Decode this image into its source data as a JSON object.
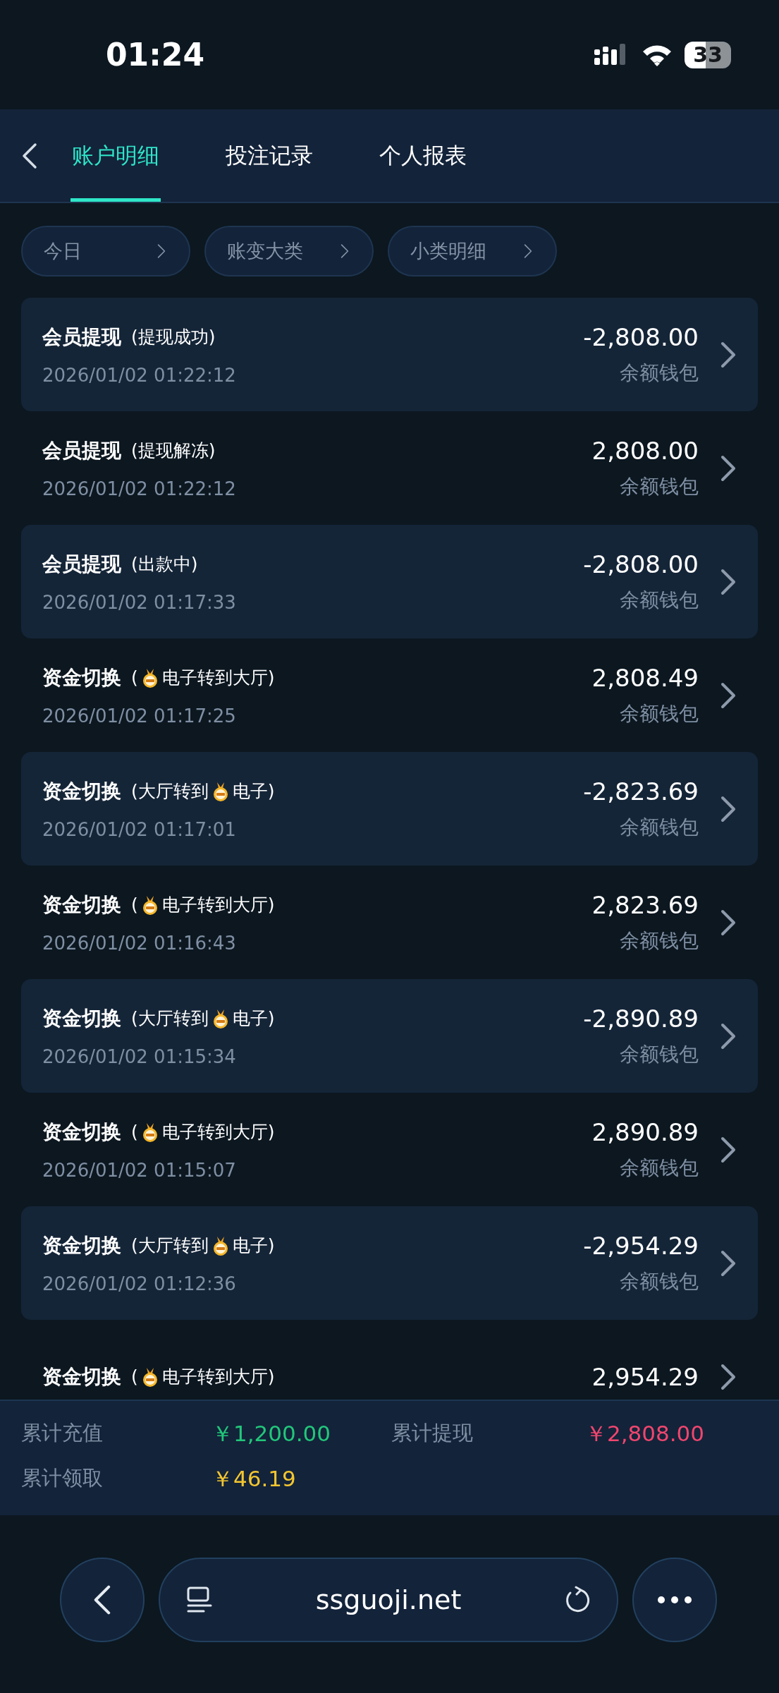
{
  "status_bar": {
    "time": "01:24",
    "battery": "33"
  },
  "tabs": [
    {
      "label": "账户明细",
      "selected": true
    },
    {
      "label": "投注记录",
      "selected": false
    },
    {
      "label": "个人报表",
      "selected": false
    }
  ],
  "filters": [
    {
      "label": "今日"
    },
    {
      "label": "账变大类"
    },
    {
      "label": "小类明细"
    }
  ],
  "records": [
    {
      "title": "会员提现",
      "detail": [
        {
          "kind": "text",
          "text": "(提现成功)"
        }
      ],
      "date": "2026/01/02 01:22:12",
      "amount": "-2,808.00",
      "wallet": "余额钱包"
    },
    {
      "title": "会员提现",
      "detail": [
        {
          "kind": "text",
          "text": "(提现解冻)"
        }
      ],
      "date": "2026/01/02 01:22:12",
      "amount": "2,808.00",
      "wallet": "余额钱包"
    },
    {
      "title": "会员提现",
      "detail": [
        {
          "kind": "text",
          "text": "(出款中)"
        }
      ],
      "date": "2026/01/02 01:17:33",
      "amount": "-2,808.00",
      "wallet": "余额钱包"
    },
    {
      "title": "资金切换",
      "detail": [
        {
          "kind": "text",
          "text": "("
        },
        {
          "kind": "coin"
        },
        {
          "kind": "text",
          "text": "电子转到大厅)"
        }
      ],
      "date": "2026/01/02 01:17:25",
      "amount": "2,808.49",
      "wallet": "余额钱包"
    },
    {
      "title": "资金切换",
      "detail": [
        {
          "kind": "text",
          "text": "(大厅转到"
        },
        {
          "kind": "coin"
        },
        {
          "kind": "text",
          "text": "电子)"
        }
      ],
      "date": "2026/01/02 01:17:01",
      "amount": "-2,823.69",
      "wallet": "余额钱包"
    },
    {
      "title": "资金切换",
      "detail": [
        {
          "kind": "text",
          "text": "("
        },
        {
          "kind": "coin"
        },
        {
          "kind": "text",
          "text": "电子转到大厅)"
        }
      ],
      "date": "2026/01/02 01:16:43",
      "amount": "2,823.69",
      "wallet": "余额钱包"
    },
    {
      "title": "资金切换",
      "detail": [
        {
          "kind": "text",
          "text": "(大厅转到"
        },
        {
          "kind": "coin"
        },
        {
          "kind": "text",
          "text": "电子)"
        }
      ],
      "date": "2026/01/02 01:15:34",
      "amount": "-2,890.89",
      "wallet": "余额钱包"
    },
    {
      "title": "资金切换",
      "detail": [
        {
          "kind": "text",
          "text": "("
        },
        {
          "kind": "coin"
        },
        {
          "kind": "text",
          "text": "电子转到大厅)"
        }
      ],
      "date": "2026/01/02 01:15:07",
      "amount": "2,890.89",
      "wallet": "余额钱包"
    },
    {
      "title": "资金切换",
      "detail": [
        {
          "kind": "text",
          "text": "(大厅转到"
        },
        {
          "kind": "coin"
        },
        {
          "kind": "text",
          "text": "电子)"
        }
      ],
      "date": "2026/01/02 01:12:36",
      "amount": "-2,954.29",
      "wallet": "余额钱包"
    },
    {
      "title": "资金切换",
      "detail": [
        {
          "kind": "text",
          "text": "("
        },
        {
          "kind": "coin"
        },
        {
          "kind": "text",
          "text": "电子转到大厅)"
        }
      ],
      "amount": "2,954.29"
    }
  ],
  "summary": [
    {
      "label": "累计充值",
      "value": "￥1,200.00",
      "color": "#22c77a"
    },
    {
      "label": "累计提现",
      "value": "￥2,808.00",
      "color": "#f0466e"
    },
    {
      "label": "累计领取",
      "value": "￥46.19",
      "color": "#f2c631"
    }
  ],
  "browser": {
    "url": "ssguoji.net"
  }
}
